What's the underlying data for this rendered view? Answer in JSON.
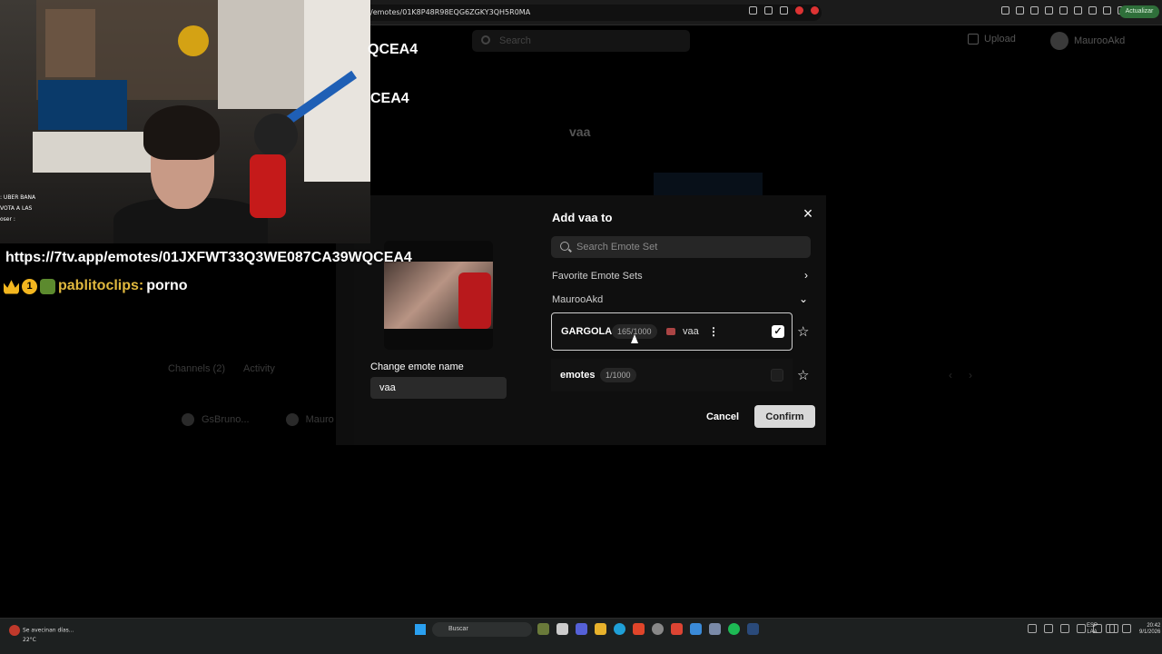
{
  "browser": {
    "url": "/emotes/01K8P48R98EQG6ZGKY3QH5R0MA",
    "update_label": "Actualizar"
  },
  "app": {
    "search_placeholder": "Search",
    "upload_label": "Upload",
    "username": "MaurooAkd",
    "emote_title_bg": "vaa",
    "bg_tabs": [
      "Channels (2)",
      "Activity"
    ],
    "bg_users": [
      "GsBruno...",
      "Mauro"
    ]
  },
  "stream_overlay": {
    "code_fragment_1": "QCEA4",
    "code_fragment_2": "CEA4",
    "chat_url": "https://7tv.app/emotes/01JXFWT33Q3WE087CA39WQCEA4",
    "chat_badge_number": "1",
    "chat_user": "pablitoclips:",
    "chat_message": "porno",
    "small_chat": [
      ": UBER BANA",
      "VOTA A LAS",
      "oser :"
    ]
  },
  "dialog": {
    "title": "Add vaa to",
    "search_placeholder": "Search Emote Set",
    "favorite_sets_label": "Favorite Emote Sets",
    "user_section_label": "MaurooAkd",
    "sets": [
      {
        "name": "GARGOLA",
        "count": "165/1000",
        "conflict_name": "vaa",
        "checked": true
      },
      {
        "name": "emotes",
        "count": "1/1000",
        "checked": false
      }
    ],
    "rename_label": "Change emote name",
    "rename_value": "vaa",
    "cancel_label": "Cancel",
    "confirm_label": "Confirm"
  },
  "taskbar": {
    "weather_line1": "Se avecinan días...",
    "weather_line2": "22°C",
    "search_label": "Buscar",
    "lang_line1": "ESP",
    "lang_line2": "LAA",
    "time": "20:42",
    "date": "9/1/2026"
  },
  "colors": {
    "confirm_bg": "#d9d9d9",
    "chat_user": "#e0b83e",
    "dialog_bg": "#0f0f0f"
  }
}
